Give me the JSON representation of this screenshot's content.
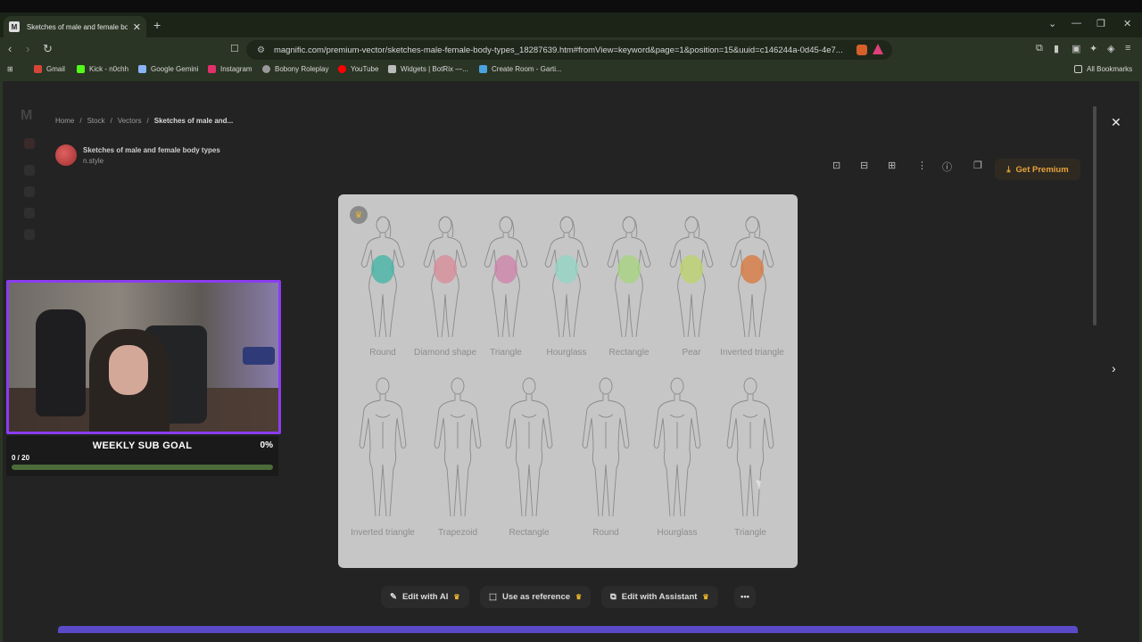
{
  "browser": {
    "tab_title": "Sketches of male and female bo...",
    "url": "magnific.com/premium-vector/sketches-male-female-body-types_18287639.htm#fromView=keyword&page=1&position=15&uuid=c146244a-0d45-4e7...",
    "bookmarks": [
      "Gmail",
      "Kick - n0chh",
      "Google Gemini",
      "Instagram",
      "Bobony Roleplay",
      "YouTube",
      "Widgets | BotRix —...",
      "Create Room - Garti..."
    ],
    "all_bookmarks": "All Bookmarks"
  },
  "breadcrumb": {
    "items": [
      "Home",
      "Stock",
      "Vectors"
    ],
    "current": "Sketches of male and..."
  },
  "author": {
    "title": "Sketches of male and female body types",
    "name": "n.style"
  },
  "premium_button": "Get Premium",
  "figures": {
    "female": [
      {
        "label": "Round",
        "color": "#3fb3a4"
      },
      {
        "label": "Diamond shape",
        "color": "#d98a98"
      },
      {
        "label": "Triangle",
        "color": "#cf80a8"
      },
      {
        "label": "Hourglass",
        "color": "#8fd6c4"
      },
      {
        "label": "Rectangle",
        "color": "#a5d47e"
      },
      {
        "label": "Pear",
        "color": "#bcd46a"
      },
      {
        "label": "Inverted triangle",
        "color": "#d9753a"
      }
    ],
    "male": [
      {
        "label": "Inverted triangle"
      },
      {
        "label": "Trapezoid"
      },
      {
        "label": "Rectangle"
      },
      {
        "label": "Round"
      },
      {
        "label": "Hourglass"
      },
      {
        "label": "Triangle"
      }
    ]
  },
  "actions": {
    "edit_ai": "Edit with AI",
    "use_reference": "Use as reference",
    "edit_assistant": "Edit with Assistant"
  },
  "overlay": {
    "goal_title": "WEEKLY SUB GOAL",
    "goal_percent": "0%",
    "goal_count": "0 / 20",
    "goal_progress": 0
  }
}
